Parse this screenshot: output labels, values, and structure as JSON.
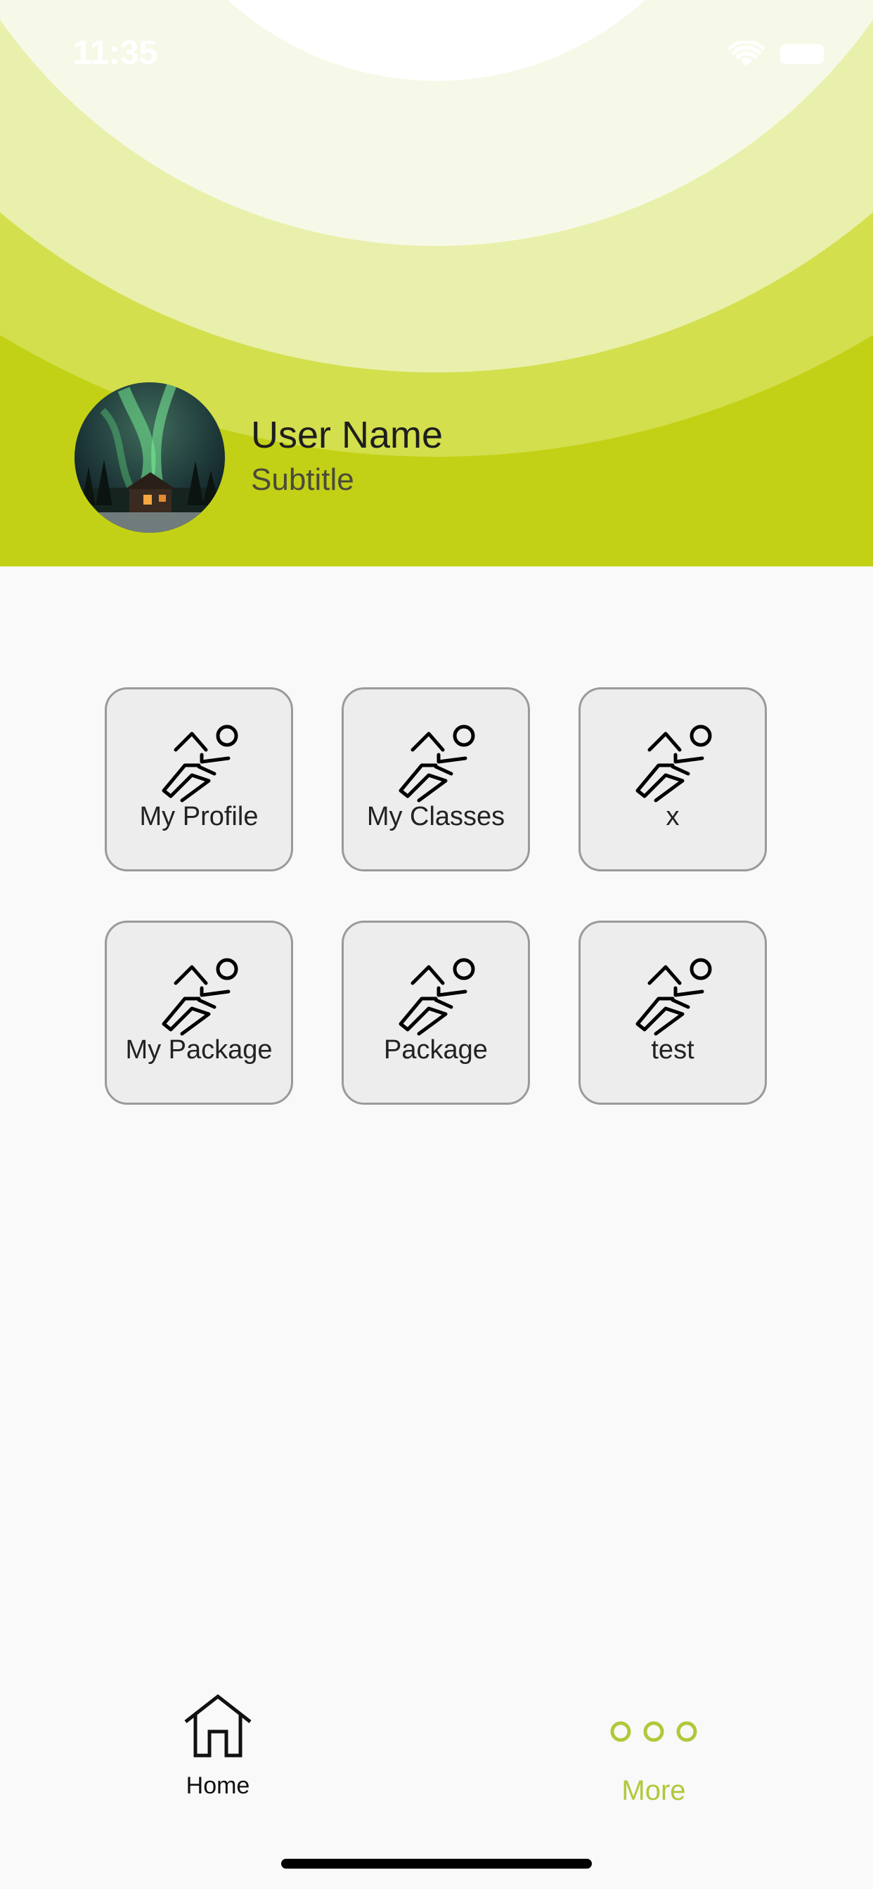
{
  "status_bar": {
    "time": "11:35"
  },
  "profile": {
    "name": "User Name",
    "subtitle": "Subtitle"
  },
  "grid": {
    "items": [
      {
        "label": "My Profile",
        "icon": "runner-icon"
      },
      {
        "label": "My Classes",
        "icon": "runner-icon"
      },
      {
        "label": "x",
        "icon": "runner-icon"
      },
      {
        "label": "My Package",
        "icon": "runner-icon"
      },
      {
        "label": "Package",
        "icon": "runner-icon"
      },
      {
        "label": "test",
        "icon": "runner-icon"
      }
    ]
  },
  "bottom_nav": {
    "items": [
      {
        "label": "Home",
        "icon": "home-icon"
      },
      {
        "label": "More",
        "icon": "more-icon",
        "active": true
      }
    ]
  },
  "colors": {
    "accent": "#c3d116",
    "active_nav": "#b3c73a"
  }
}
